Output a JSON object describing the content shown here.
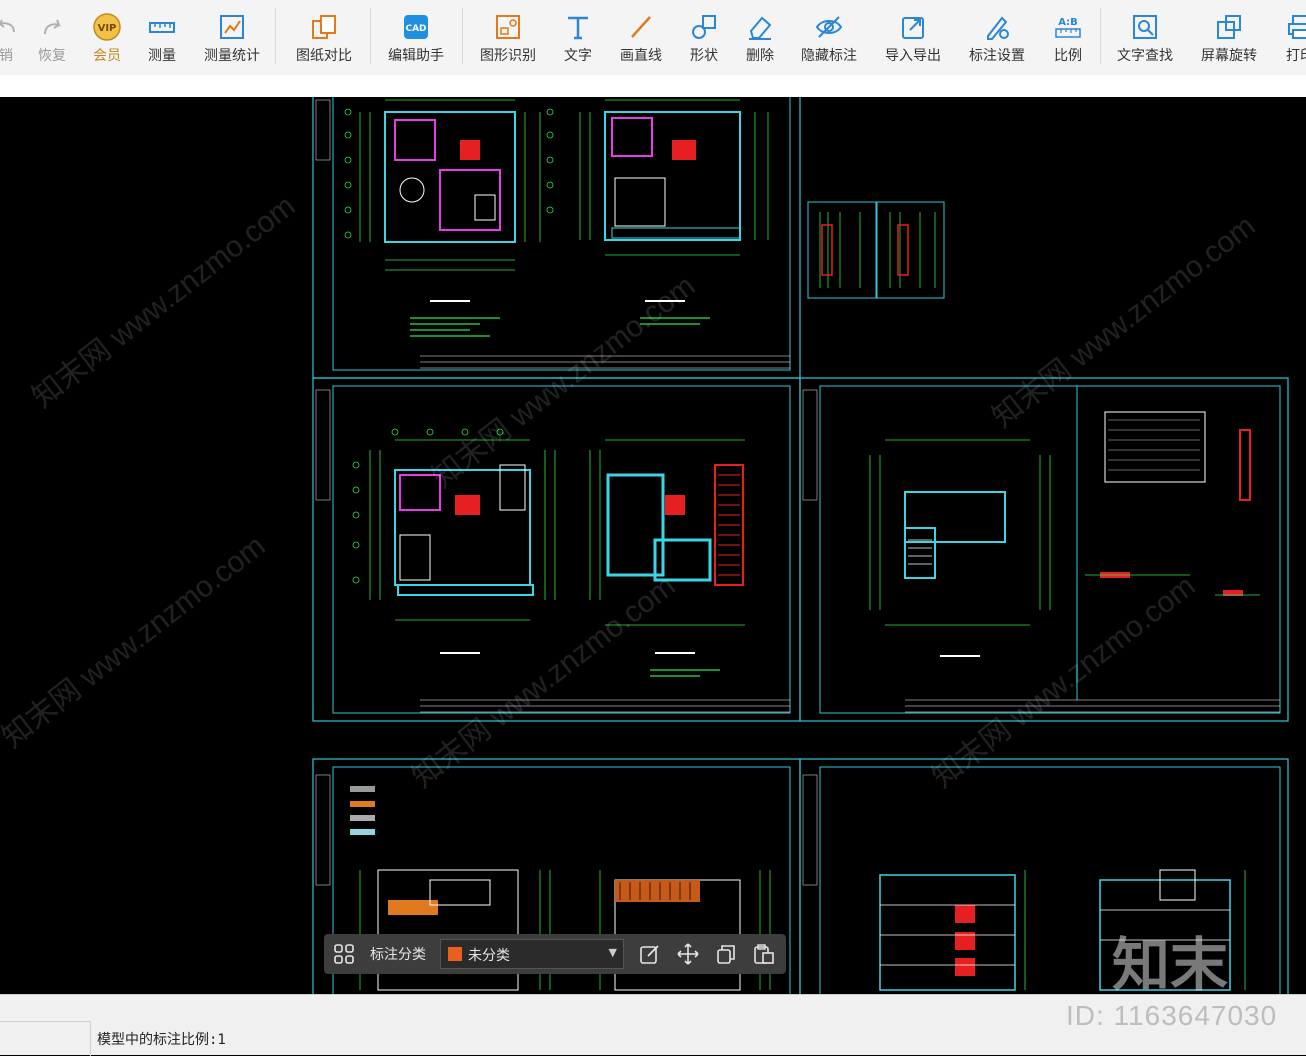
{
  "toolbar": {
    "items": [
      {
        "label": "销",
        "icon": "undo-icon",
        "disabled": true
      },
      {
        "label": "恢复",
        "icon": "redo-icon",
        "disabled": true
      },
      {
        "label": "会员",
        "icon": "vip-icon",
        "vip": true
      },
      {
        "label": "测量",
        "icon": "measure-icon"
      },
      {
        "label": "测量统计",
        "icon": "measure-stats-icon"
      },
      {
        "label": "图纸对比",
        "icon": "compare-icon"
      },
      {
        "label": "编辑助手",
        "icon": "cad-edit-icon"
      },
      {
        "label": "图形识别",
        "icon": "shape-recognize-icon"
      },
      {
        "label": "文字",
        "icon": "text-icon"
      },
      {
        "label": "画直线",
        "icon": "line-icon"
      },
      {
        "label": "形状",
        "icon": "shape-icon"
      },
      {
        "label": "删除",
        "icon": "eraser-icon"
      },
      {
        "label": "隐藏标注",
        "icon": "hide-eye-icon"
      },
      {
        "label": "导入导出",
        "icon": "import-export-icon"
      },
      {
        "label": "标注设置",
        "icon": "annotation-settings-icon"
      },
      {
        "label": "比例",
        "icon": "scale-icon"
      },
      {
        "label": "文字查找",
        "icon": "text-search-icon"
      },
      {
        "label": "屏幕旋转",
        "icon": "rotate-screen-icon"
      },
      {
        "label": "打印",
        "icon": "print-icon"
      }
    ]
  },
  "bottom_toolbar": {
    "category_label": "标注分类",
    "category_value": "未分类",
    "category_color": "#e8601c"
  },
  "status": {
    "scale_text": "模型中的标注比例:1"
  },
  "watermarks": {
    "id_text": "ID: 1163647030",
    "logo_text": "知末",
    "diagonal_text": "知末网 www.znzmo.com"
  },
  "colors": {
    "sheet_border": "#2fc7d6",
    "wall_magenta": "#e63ce6",
    "wall_cyan": "#3ad6e6",
    "dim_green": "#2be34a",
    "accent_red": "#e62020"
  }
}
